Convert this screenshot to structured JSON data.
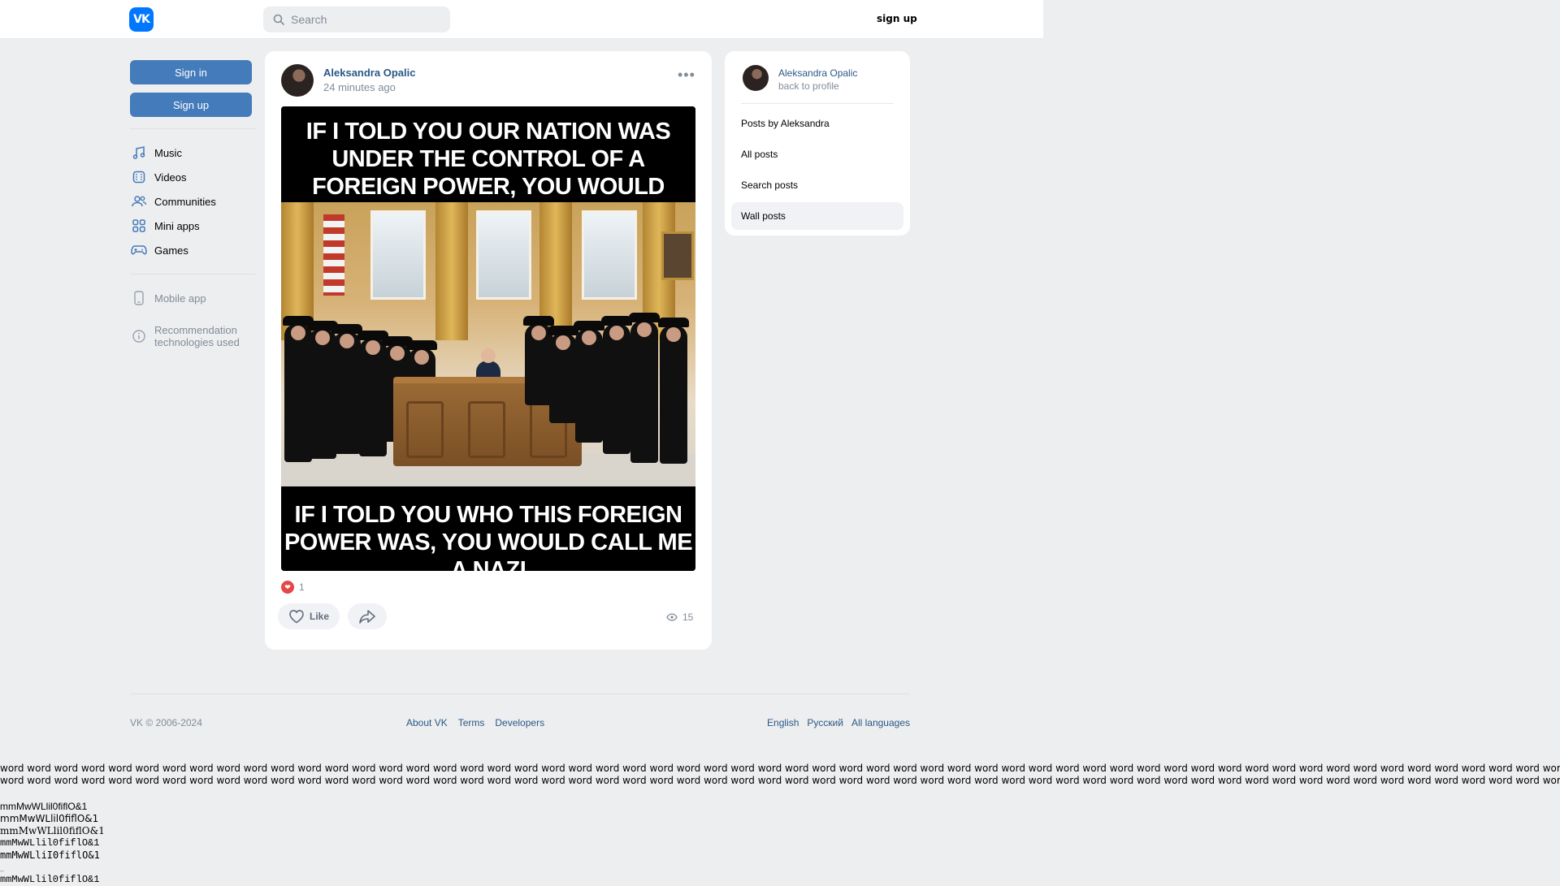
{
  "header": {
    "logo_text": "VK",
    "search_placeholder": "Search",
    "signup_label": "sign up"
  },
  "sidebar": {
    "signin_label": "Sign in",
    "signup_label": "Sign up",
    "items": [
      {
        "label": "Music",
        "icon": "music-icon"
      },
      {
        "label": "Videos",
        "icon": "video-icon"
      },
      {
        "label": "Communities",
        "icon": "communities-icon"
      },
      {
        "label": "Mini apps",
        "icon": "mini-apps-icon"
      },
      {
        "label": "Games",
        "icon": "games-icon"
      }
    ],
    "secondary": [
      {
        "label": "Mobile app",
        "icon": "phone-icon"
      },
      {
        "label": "Recommendation technologies used",
        "icon": "info-icon"
      }
    ]
  },
  "post": {
    "author": "Aleksandra Opalic",
    "time": "24 minutes ago",
    "image_top_text": "If I told you our nation was under the control of a foreign power, you would call me a patriot",
    "image_bottom_text": "If I told you who this foreign power was, you would call me a nazi",
    "reaction_count": "1",
    "like_label": "Like",
    "views": "15"
  },
  "profile_card": {
    "name": "Aleksandra Opalic",
    "back_label": "back to profile",
    "items": [
      {
        "label": "Posts by Aleksandra",
        "active": false
      },
      {
        "label": "All posts",
        "active": false
      },
      {
        "label": "Search posts",
        "active": false
      },
      {
        "label": "Wall posts",
        "active": true
      }
    ]
  },
  "footer": {
    "copyright": "VK © 2006-2024",
    "links": [
      "About VK",
      "Terms",
      "Developers"
    ],
    "languages": [
      "English",
      "Русский",
      "All languages"
    ]
  },
  "debug": {
    "words_line_1": "word word word word word word word word word word word word word word word word word word word word word word word word word word word word word word word word word word word word word word word word word word word word word word word word word word word word word word word word word word word word word word",
    "words_line_2": "word word word word word word word word word word word word word word word word word word word word word word word word word word word word word word word word word word word word word word word word word word word word word word word word word word word word word word word word word word word word word word",
    "glyph_lines": [
      "mmMwWLlil0fiflO&1",
      "mmMwWLlil0fiflO&1",
      "mmMwWLlil0fiflO&1",
      "mmMwWLlil0fiflO&1",
      "mmMwWLliI0fiflO&1"
    ],
    "glyph_last": "mmMwWLlil0fiflO&1"
  }
}
